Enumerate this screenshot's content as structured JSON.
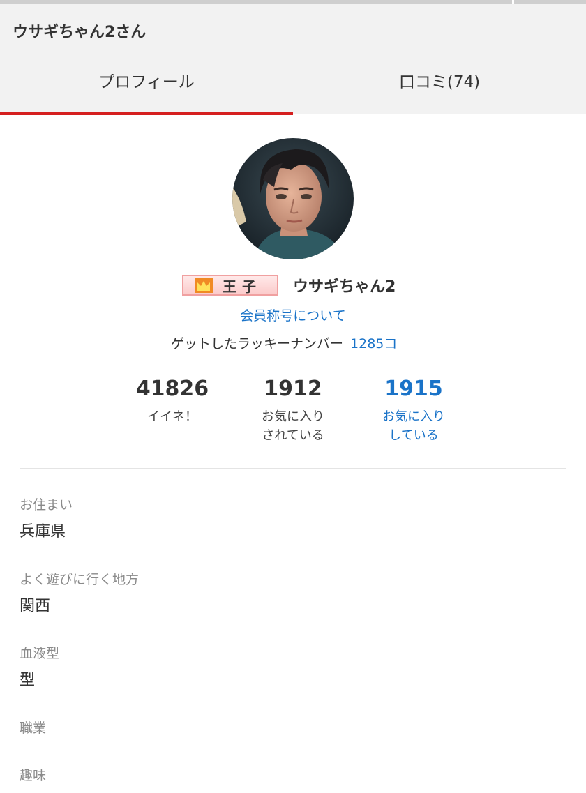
{
  "header": {
    "title": "ウサギちゃん2さん",
    "tabs": [
      {
        "label": "プロフィール",
        "active": true
      },
      {
        "label": "口コミ(74)",
        "active": false
      }
    ],
    "background_color": "#f2f2f2",
    "active_tab_color": "#d51f1f"
  },
  "profile": {
    "badge_text": "王子",
    "badge_icon": "crown-icon",
    "username": "ウサギちゃん2",
    "rank_link": "会員称号について",
    "lucky_label": "ゲットしたラッキーナンバー",
    "lucky_count": "1285コ",
    "link_color": "#1a73c8"
  },
  "stats": [
    {
      "value": "41826",
      "label": "イイネ！"
    },
    {
      "value": "1912",
      "label": "お気に入り\nされている"
    },
    {
      "value": "1915",
      "label": "お気に入り\nしている"
    }
  ],
  "fields": [
    {
      "label": "お住まい",
      "value": "兵庫県"
    },
    {
      "label": "よく遊びに行く地方",
      "value": "関西"
    },
    {
      "label": "血液型",
      "value": "型"
    },
    {
      "label": "職業",
      "value": ""
    },
    {
      "label": "趣味",
      "value": ""
    }
  ]
}
